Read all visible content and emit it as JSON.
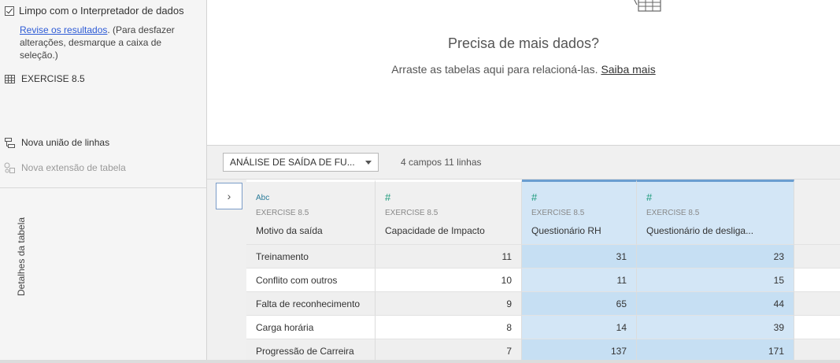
{
  "left_panel": {
    "interpreter_label": "Limpo com o Interpretador de dados",
    "review_link": "Revise os resultados",
    "review_note": ". (Para desfazer alterações, desmarque a caixa de seleção.)",
    "table_item": "EXERCISE 8.5",
    "new_union": "Nova união de linhas",
    "new_extension": "Nova extensão de tabela"
  },
  "drop_area": {
    "title": "Precisa de mais dados?",
    "subtitle": "Arraste as tabelas aqui para relacioná-las.",
    "learn_more": "Saiba mais"
  },
  "toolbar": {
    "table_select": "ANÁLISE DE SAÍDA DE FU...",
    "count": "4 campos 11 linhas"
  },
  "side": {
    "expand_glyph": "›",
    "label": "Detalhes da tabela"
  },
  "grid": {
    "columns": [
      {
        "type": "Abc",
        "source": "EXERCISE 8.5",
        "name": "Motivo da saída"
      },
      {
        "type": "#",
        "source": "EXERCISE 8.5",
        "name": "Capacidade de Impacto"
      },
      {
        "type": "#",
        "source": "EXERCISE 8.5",
        "name": "Questionário RH"
      },
      {
        "type": "#",
        "source": "EXERCISE 8.5",
        "name": "Questionário de desliga..."
      }
    ],
    "rows": [
      [
        "Treinamento",
        "11",
        "31",
        "23"
      ],
      [
        "Conflito com outros",
        "10",
        "11",
        "15"
      ],
      [
        "Falta de reconhecimento",
        "9",
        "65",
        "44"
      ],
      [
        "Carga horária",
        "8",
        "14",
        "39"
      ],
      [
        "Progressão de Carreira",
        "7",
        "137",
        "171"
      ]
    ]
  },
  "colors": {
    "selected_column": "#d3e6f6",
    "selected_accent": "#6a9ed0",
    "link": "#2d5bd6"
  }
}
